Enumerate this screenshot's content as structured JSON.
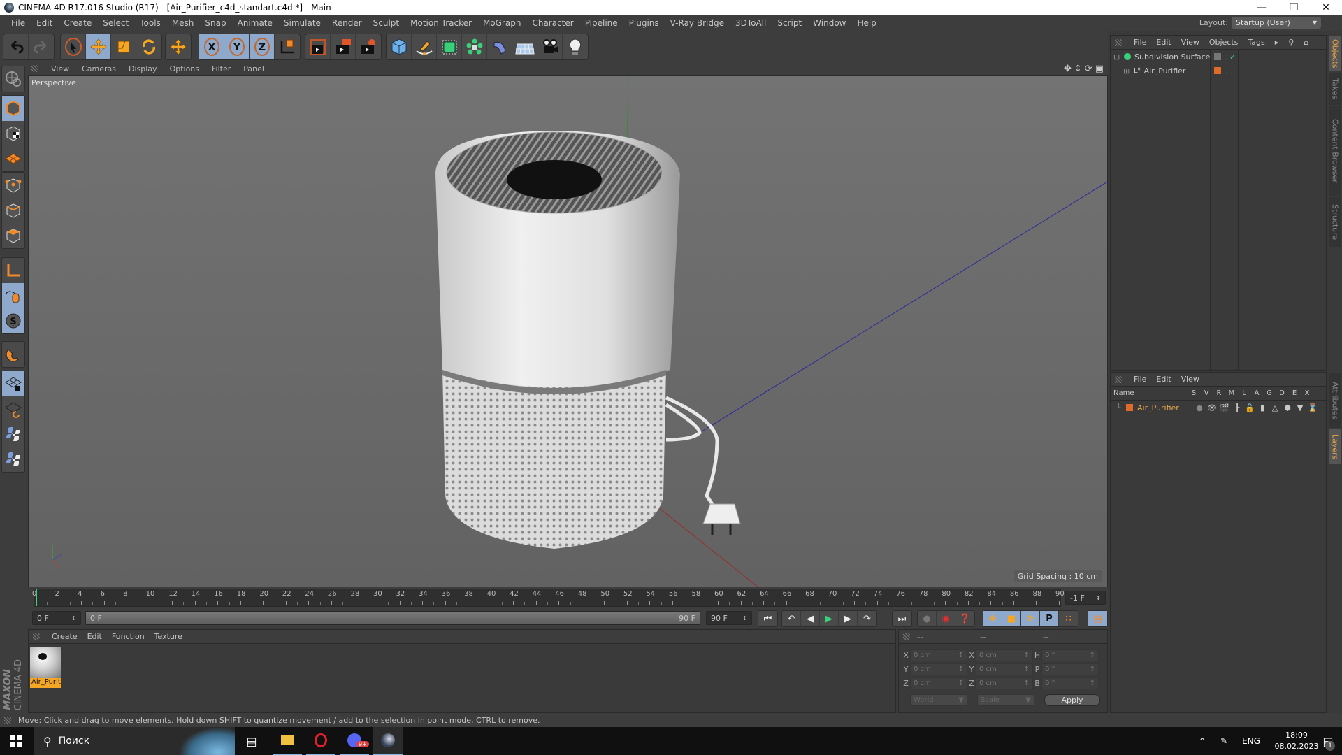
{
  "window": {
    "title": "CINEMA 4D R17.016 Studio (R17) - [Air_Purifier_c4d_standart.c4d *] - Main",
    "controls": [
      "minimize",
      "maximize",
      "close"
    ]
  },
  "menubar": {
    "items": [
      "File",
      "Edit",
      "Create",
      "Select",
      "Tools",
      "Mesh",
      "Snap",
      "Animate",
      "Simulate",
      "Render",
      "Sculpt",
      "Motion Tracker",
      "MoGraph",
      "Character",
      "Pipeline",
      "Plugins",
      "V-Ray Bridge",
      "3DToAll",
      "Script",
      "Window",
      "Help"
    ],
    "layout_label": "Layout:",
    "layout_value": "Startup (User)"
  },
  "toolbar": {
    "groups": [
      [
        "undo-icon",
        "redo-icon"
      ],
      [
        "live-selection-icon",
        "move-icon",
        "scale-icon",
        "rotate-icon"
      ],
      [
        "recent-tool-icon"
      ],
      [
        "x-axis-lock-icon",
        "y-axis-lock-icon",
        "z-axis-lock-icon",
        "coordinate-system-icon"
      ],
      [
        "render-view-icon",
        "render-picture-viewer-icon",
        "render-settings-icon"
      ],
      [
        "cube-primitive-icon",
        "pen-spline-icon",
        "subdivision-surface-icon",
        "cloner-icon",
        "deformer-icon",
        "floor-icon",
        "camera-icon",
        "light-icon"
      ]
    ]
  },
  "lefttools": [
    "make-editable-icon",
    "model-mode-icon",
    "texture-mode-icon",
    "workplane-mode-icon",
    "points-mode-icon",
    "edges-mode-icon",
    "polygons-mode-icon",
    "axis-mode-icon",
    "tweak-mode-icon",
    "solo-icon",
    "snap-icon",
    "locked-workplane-icon",
    "planar-workplane-icon",
    "python-icon",
    "python-script-icon"
  ],
  "viewport": {
    "menu": [
      "View",
      "Cameras",
      "Display",
      "Options",
      "Filter",
      "Panel"
    ],
    "label": "Perspective",
    "grid_spacing": "Grid Spacing : 10 cm"
  },
  "objects_panel": {
    "menu": [
      "File",
      "Edit",
      "View",
      "Objects",
      "Tags"
    ],
    "items": [
      {
        "name": "Subdivision Surface",
        "level": 0,
        "expanded": true,
        "enabled": true
      },
      {
        "name": "Air_Purifier",
        "level": 1,
        "expanded": false,
        "layer_color": "#e06a2a"
      }
    ]
  },
  "layers_panel": {
    "menu": [
      "File",
      "Edit",
      "View"
    ],
    "columns": [
      "Name",
      "S",
      "V",
      "R",
      "M",
      "L",
      "A",
      "G",
      "D",
      "E",
      "X"
    ],
    "rows": [
      {
        "name": "Air_Purifier",
        "color": "#e06a2a"
      }
    ]
  },
  "side_tabs": {
    "top": [
      "Objects",
      "Takes",
      "Content Browser",
      "Structure"
    ],
    "bottom": [
      "Attributes",
      "Layers"
    ],
    "active_top": "Objects",
    "active_bottom": "Layers"
  },
  "timeline": {
    "ticks": [
      "0",
      "2",
      "4",
      "6",
      "8",
      "10",
      "12",
      "14",
      "16",
      "18",
      "20",
      "22",
      "24",
      "26",
      "28",
      "30",
      "32",
      "34",
      "36",
      "38",
      "40",
      "42",
      "44",
      "46",
      "48",
      "50",
      "52",
      "54",
      "56",
      "58",
      "60",
      "62",
      "64",
      "66",
      "68",
      "70",
      "72",
      "74",
      "76",
      "78",
      "80",
      "82",
      "84",
      "86",
      "88",
      "90"
    ],
    "current_frame_right": "-1 F",
    "start_frame": "0 F",
    "range_start": "0 F",
    "range_end": "90 F",
    "end_frame": "90 F",
    "playback_buttons": [
      "go-to-start",
      "previous-key",
      "previous-frame",
      "play",
      "next-frame",
      "next-key",
      "go-to-end"
    ]
  },
  "material_panel": {
    "menu": [
      "Create",
      "Edit",
      "Function",
      "Texture"
    ],
    "materials": [
      {
        "name": "Air_Purit"
      }
    ]
  },
  "coordinates_panel": {
    "headers": [
      "--",
      "--",
      "--"
    ],
    "rows": [
      {
        "l1": "X",
        "v1": "0 cm",
        "l2": "X",
        "v2": "0 cm",
        "l3": "H",
        "v3": "0 °"
      },
      {
        "l1": "Y",
        "v1": "0 cm",
        "l2": "Y",
        "v2": "0 cm",
        "l3": "P",
        "v3": "0 °"
      },
      {
        "l1": "Z",
        "v1": "0 cm",
        "l2": "Z",
        "v2": "0 cm",
        "l3": "B",
        "v3": "0 °"
      }
    ],
    "space_select": "World",
    "mode_select": "Scale",
    "apply_label": "Apply"
  },
  "brand": {
    "line1": "MAXON",
    "line2": "CINEMA 4D"
  },
  "statusbar": {
    "text": "Move: Click and drag to move elements. Hold down SHIFT to quantize movement / add to the selection in point mode, CTRL to remove."
  },
  "taskbar": {
    "search_placeholder": "Поиск",
    "apps": [
      "task-view",
      "file-explorer",
      "opera",
      "discord",
      "cinema4d"
    ],
    "discord_badge": "9+",
    "language": "ENG",
    "time": "18:09",
    "date": "08.02.2023",
    "notifications": "1"
  }
}
